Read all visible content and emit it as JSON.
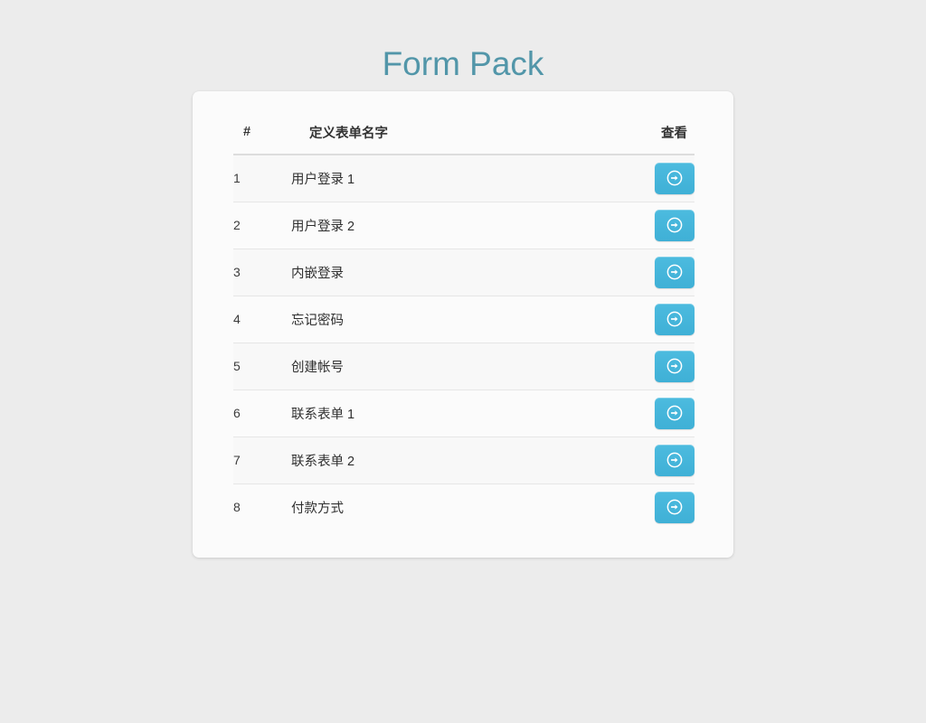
{
  "page": {
    "title": "Form Pack",
    "background_color": "#ececec",
    "title_color": "#5296a9"
  },
  "table": {
    "headers": {
      "number": "#",
      "name": "定义表单名字",
      "view": "查看"
    },
    "accent_color": "#45b6dc",
    "view_icon": "arrow-circle-right-icon",
    "rows": [
      {
        "number": "1",
        "name": "用户登录 1"
      },
      {
        "number": "2",
        "name": "用户登录 2"
      },
      {
        "number": "3",
        "name": "内嵌登录"
      },
      {
        "number": "4",
        "name": "忘记密码"
      },
      {
        "number": "5",
        "name": "创建帐号"
      },
      {
        "number": "6",
        "name": "联系表单 1"
      },
      {
        "number": "7",
        "name": "联系表单 2"
      },
      {
        "number": "8",
        "name": "付款方式"
      }
    ]
  }
}
